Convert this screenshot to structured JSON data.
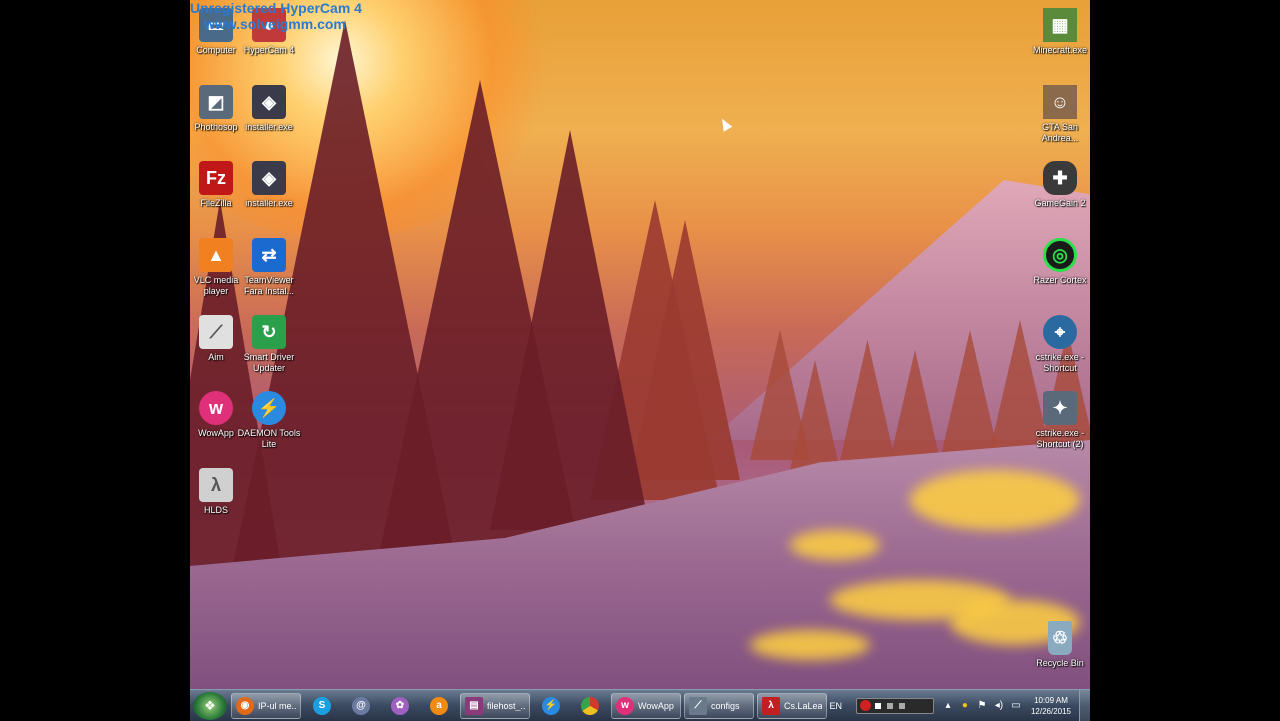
{
  "watermark": {
    "line1": "Unregistered HyperCam 4",
    "line2": "www.solveigmm.com"
  },
  "desktop_icons_left": [
    {
      "label": "Computer",
      "icon": "computer-icon",
      "color": "#4a6a8a"
    },
    {
      "label": "HyperCam 4",
      "icon": "hypercam-icon",
      "color": "#c03a3a"
    },
    {
      "label": "Phothosop",
      "icon": "photoshop-icon",
      "color": "#5a6a7a"
    },
    {
      "label": "installer.exe",
      "icon": "installer-icon",
      "color": "#3a3a4a"
    },
    {
      "label": "FileZilla",
      "icon": "filezilla-icon",
      "color": "#c01818"
    },
    {
      "label": "installer.exe",
      "icon": "installer-icon",
      "color": "#3a3a4a"
    },
    {
      "label": "VLC media player",
      "icon": "vlc-icon",
      "color": "#f08020"
    },
    {
      "label": "TeamViewer Fara Instal...",
      "icon": "teamviewer-icon",
      "color": "#1a6ad0"
    },
    {
      "label": "Aim",
      "icon": "aim-icon",
      "color": "#e0e0e0"
    },
    {
      "label": "Smart Driver Updater",
      "icon": "driver-updater-icon",
      "color": "#2aa04a"
    },
    {
      "label": "WowApp",
      "icon": "wowapp-icon",
      "color": "#e0307a"
    },
    {
      "label": "DAEMON Tools Lite",
      "icon": "daemon-tools-icon",
      "color": "#2a8ae0"
    },
    {
      "label": "HLDS",
      "icon": "hlds-icon",
      "color": "#d0d0d0"
    }
  ],
  "desktop_icons_right": [
    {
      "label": "Minecraft.exe",
      "icon": "minecraft-icon",
      "color": "#5a8a3a"
    },
    {
      "label": "GTA San Andrea...",
      "icon": "gta-icon",
      "color": "#8a6a4a"
    },
    {
      "label": "GameGain 2",
      "icon": "gamepad-icon",
      "color": "#3a3a3a"
    },
    {
      "label": "Razer Cortex",
      "icon": "razer-cortex-icon",
      "color": "#1a1a1a"
    },
    {
      "label": "cstrike.exe - Shortcut",
      "icon": "cstrike-icon",
      "color": "#2a6aa0"
    },
    {
      "label": "cstrike.exe - Shortcut (2)",
      "icon": "cstrike-icon",
      "color": "#5a6a7a"
    },
    {
      "label": "Recycle Bin",
      "icon": "recycle-bin-icon",
      "color": "#8aaac0"
    }
  ],
  "taskbar": {
    "items": [
      {
        "label": "IP-ul me...",
        "icon": "firefox-icon",
        "color": "#e06a1a",
        "type": "wide"
      },
      {
        "label": "",
        "icon": "skype-icon",
        "color": "#1aa0e0",
        "type": "pin"
      },
      {
        "label": "",
        "icon": "browser-swirl-icon",
        "color": "#6a7aa0",
        "type": "pin"
      },
      {
        "label": "",
        "icon": "bird-icon",
        "color": "#a060c0",
        "type": "pin"
      },
      {
        "label": "",
        "icon": "avast-icon",
        "color": "#f08a10",
        "type": "pin"
      },
      {
        "label": "filehost_...",
        "icon": "winrar-icon",
        "color": "#8a3a7a",
        "type": "wide"
      },
      {
        "label": "",
        "icon": "daemon-tools-icon",
        "color": "#2a8ae0",
        "type": "pin"
      },
      {
        "label": "",
        "icon": "chrome-icon",
        "color": "#3aa04a",
        "type": "pin"
      },
      {
        "label": "WowApp",
        "icon": "wowapp-icon",
        "color": "#e0307a",
        "type": "wide"
      },
      {
        "label": "configs",
        "icon": "folder-icon",
        "color": "#6a7a8a",
        "type": "wide"
      },
      {
        "label": "Cs.LaLea...",
        "icon": "half-life-icon",
        "color": "#c02020",
        "type": "wide"
      }
    ],
    "language": "EN",
    "time": "10:09 AM",
    "date": "12/26/2015"
  }
}
